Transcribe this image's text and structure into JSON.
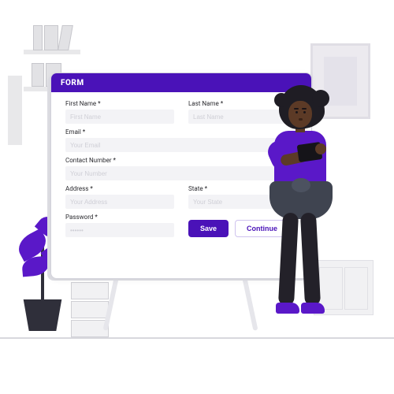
{
  "colors": {
    "accent": "#4a12b8",
    "leaf": "#5a18c8"
  },
  "form": {
    "header": "FORM",
    "fields": {
      "first_name": {
        "label": "First Name *",
        "placeholder": "First Name"
      },
      "last_name": {
        "label": "Last Name *",
        "placeholder": "Last Name"
      },
      "email": {
        "label": "Email *",
        "placeholder": "Your Email"
      },
      "contact": {
        "label": "Contact Number *",
        "placeholder": "Your Number"
      },
      "address": {
        "label": "Address *",
        "placeholder": "Your Address"
      },
      "state": {
        "label": "State *",
        "placeholder": "Your State"
      },
      "password": {
        "label": "Password *",
        "placeholder": "••••••"
      }
    },
    "buttons": {
      "save": "Save",
      "continue": "Continue"
    }
  }
}
